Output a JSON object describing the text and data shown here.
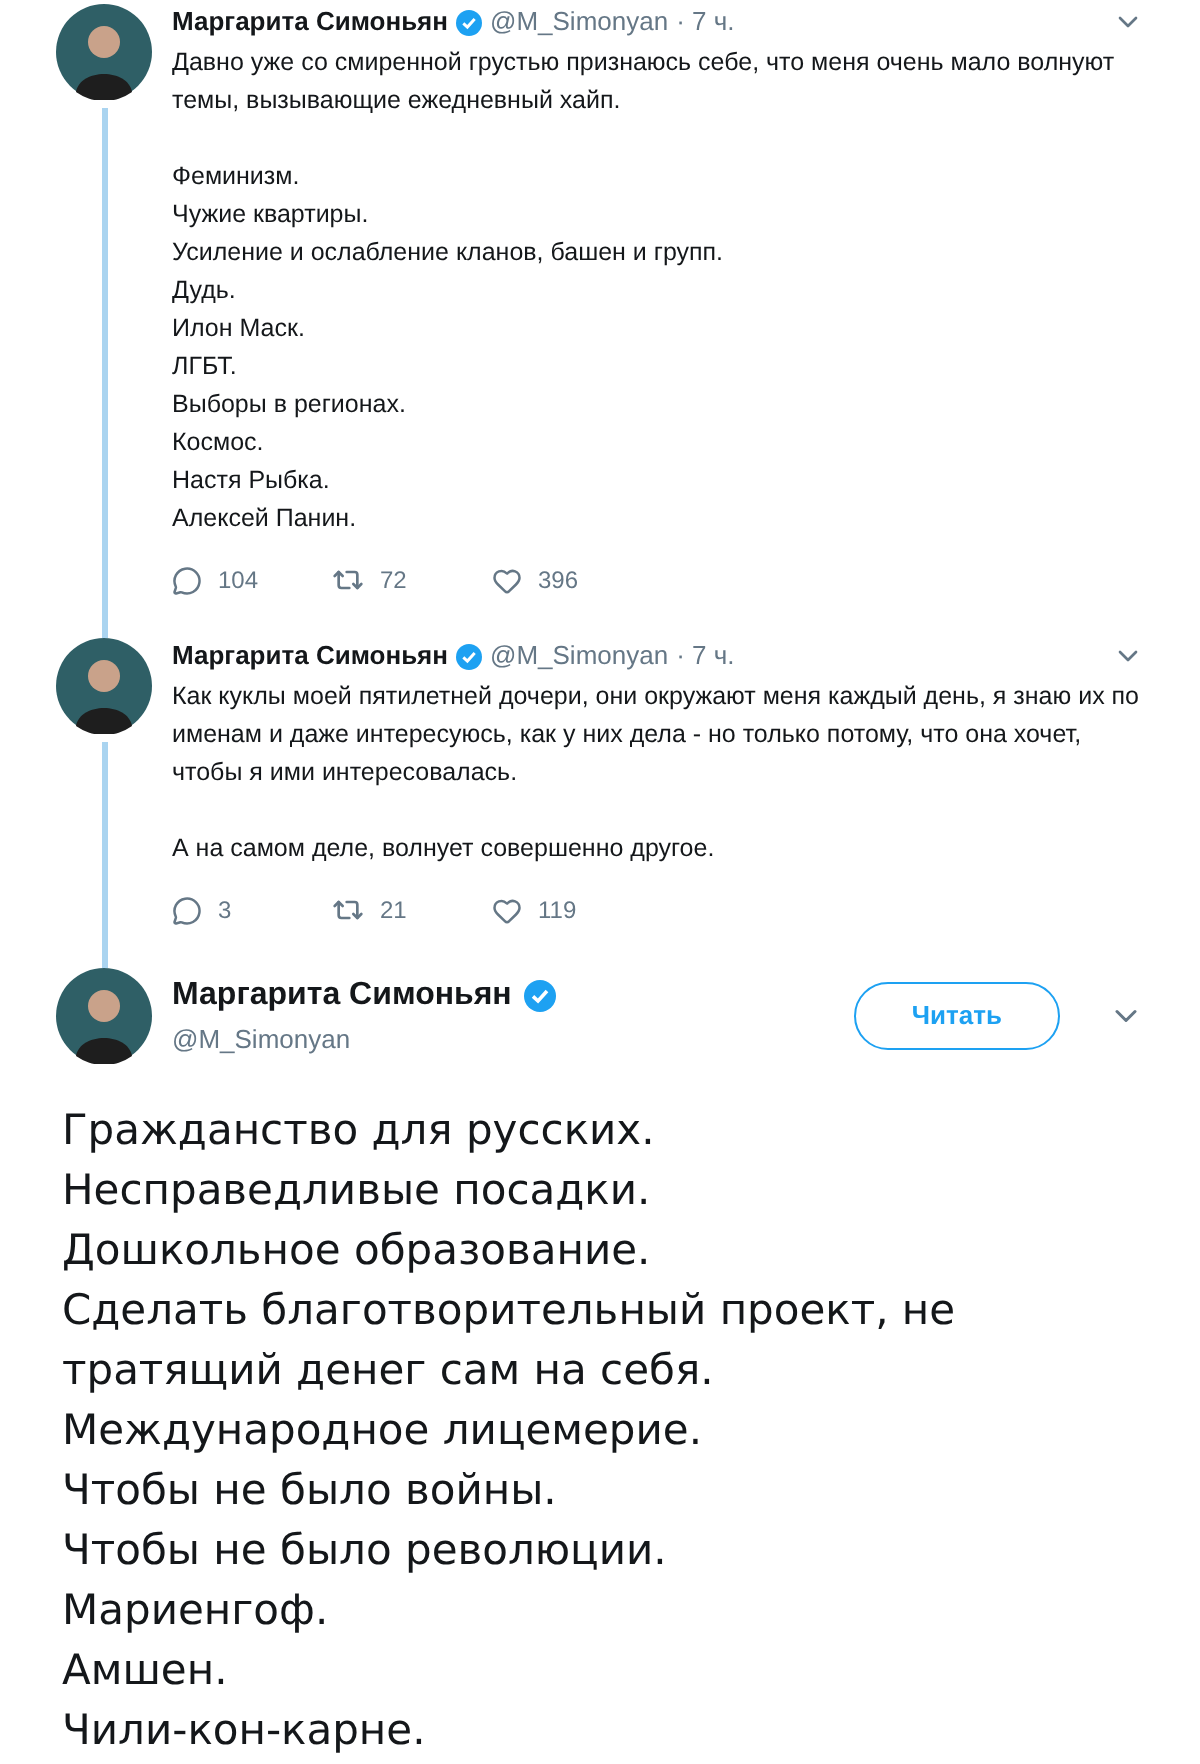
{
  "thread": [
    {
      "name": "Маргарита Симоньян",
      "verified": true,
      "handle": "@M_Simonyan",
      "time": "· 7 ч.",
      "paragraphs": [
        [
          "Давно уже со смиренной грустью признаюсь себе, что меня очень мало волнуют темы, вызывающие ежедневный хайп."
        ],
        [
          "Феминизм.",
          "Чужие квартиры.",
          "Усиление и ослабление кланов, башен и групп.",
          "Дудь.",
          "Илон Маск.",
          "ЛГБТ.",
          "Выборы в регионах.",
          "Космос.",
          "Настя Рыбка.",
          "Алексей Панин."
        ]
      ],
      "replies": "104",
      "retweets": "72",
      "likes": "396"
    },
    {
      "name": "Маргарита Симоньян",
      "verified": true,
      "handle": "@M_Simonyan",
      "time": "· 7 ч.",
      "paragraphs": [
        [
          "Как куклы моей пятилетней дочери, они окружают меня каждый день, я знаю их по именам и даже интересуюсь, как у них дела - но только потому, что она хочет, чтобы я ими интересовалась."
        ],
        [
          "А на самом деле, волнует совершенно другое."
        ]
      ],
      "replies": "3",
      "retweets": "21",
      "likes": "119"
    }
  ],
  "main_tweet": {
    "name": "Маргарита Симоньян",
    "verified": true,
    "handle": "@M_Simonyan",
    "follow_button": "Читать",
    "lines": [
      "Гражданство для русских.",
      "Несправедливые посадки.",
      "Дошкольное образование.",
      "Сделать благотворительный проект, не тратящий денег сам на себя.",
      "Международное лицемерие.",
      "Чтобы не было войны.",
      "Чтобы не было революции.",
      "Мариенгоф.",
      "Амшен.",
      "Чили-кон-карне."
    ]
  }
}
